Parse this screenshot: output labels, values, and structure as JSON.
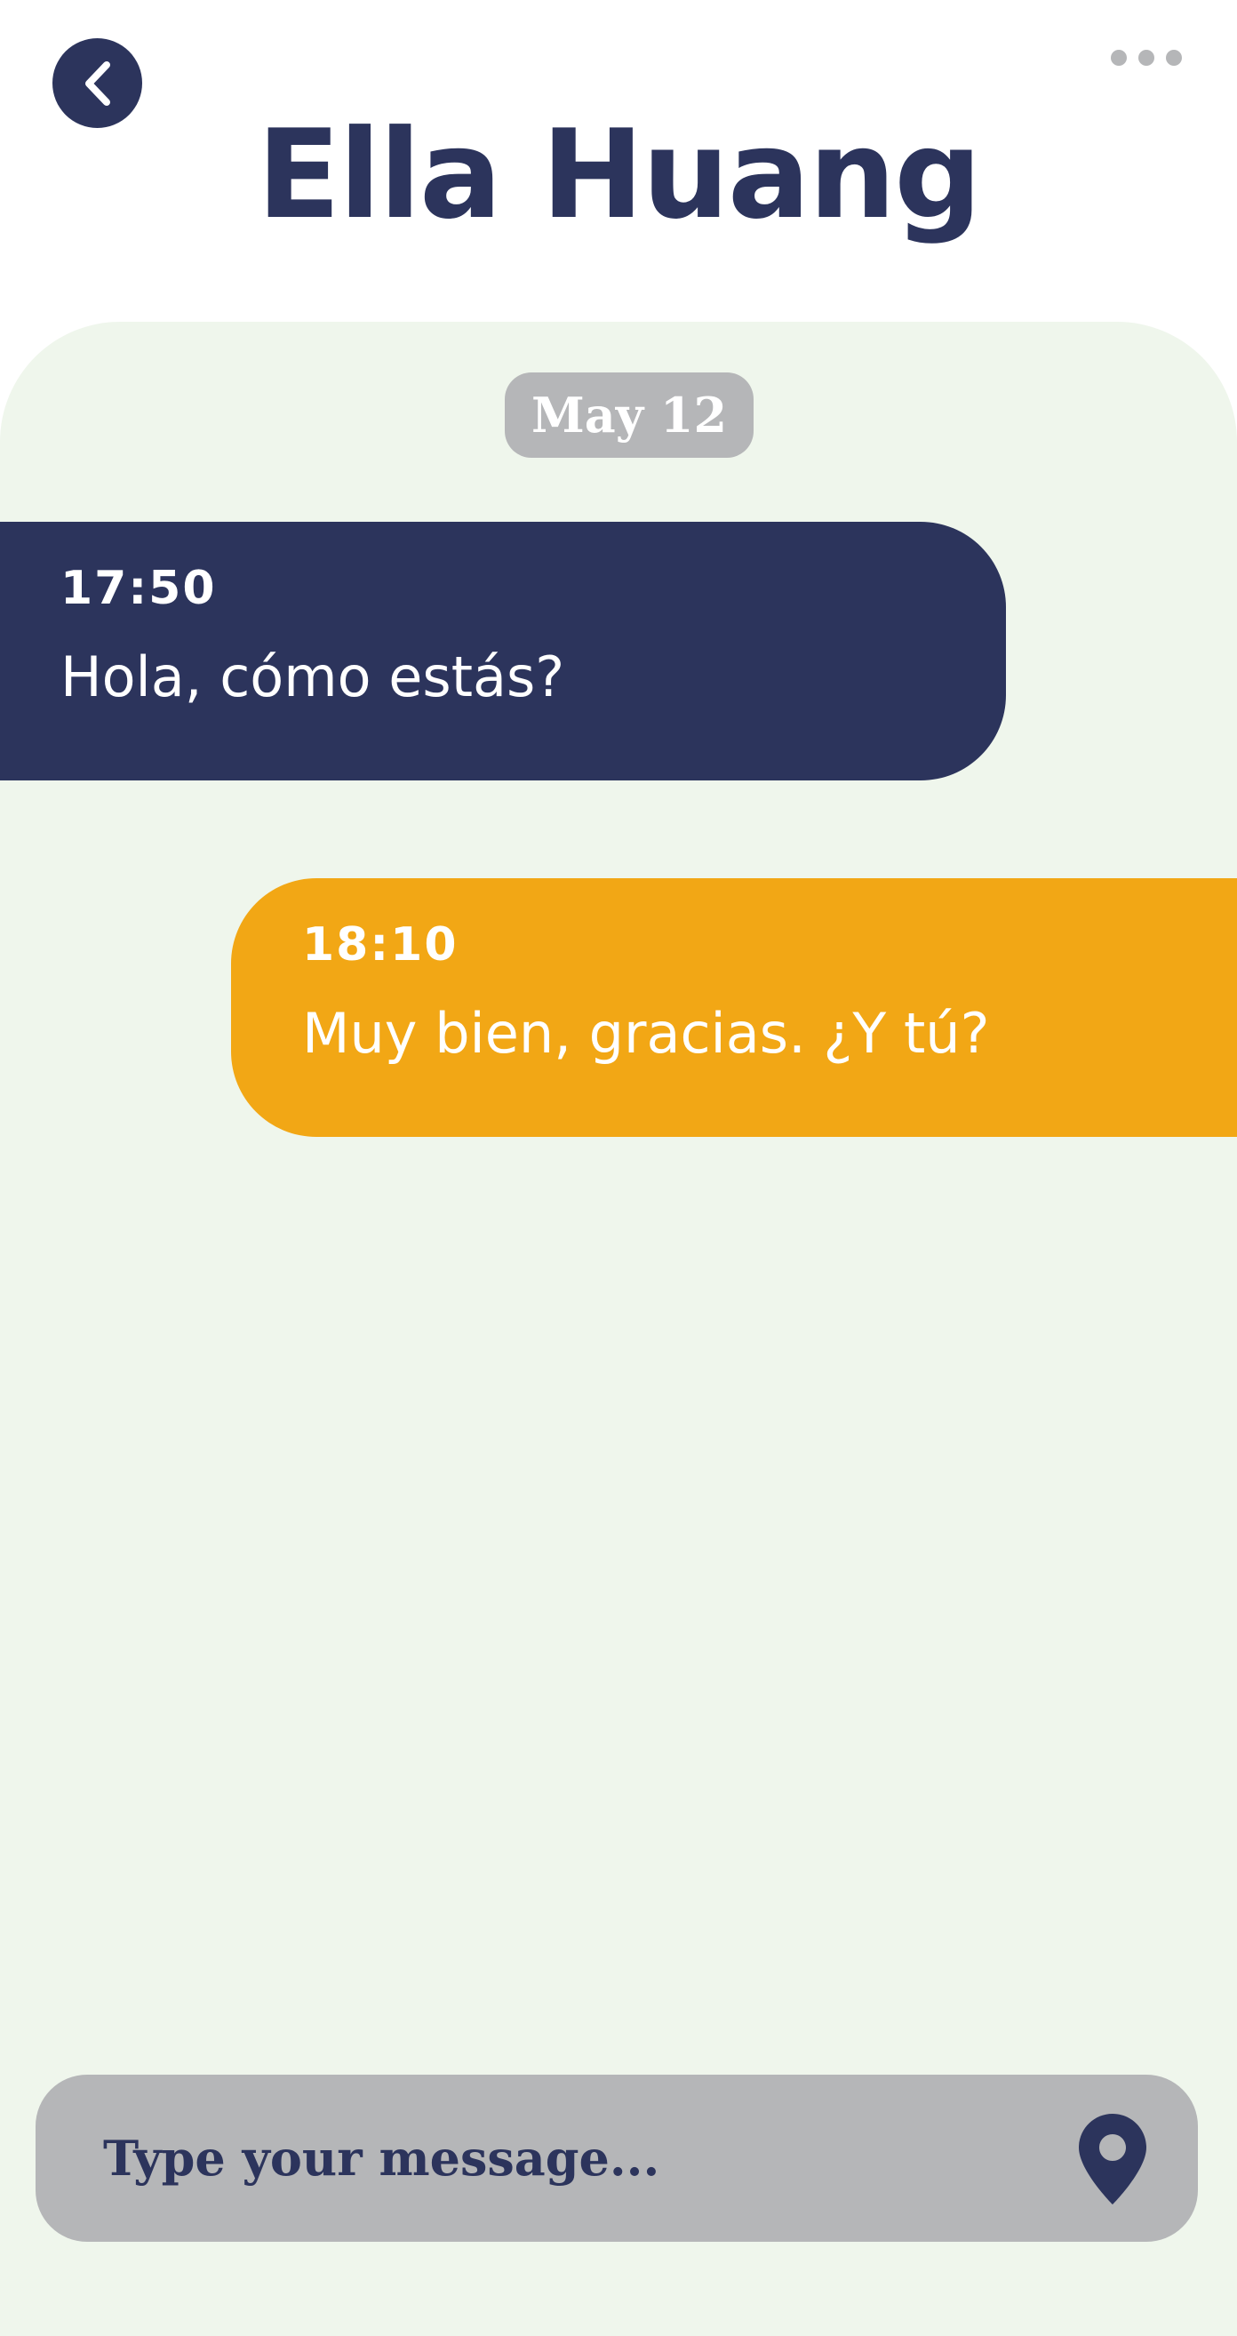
{
  "header": {
    "title": "Ella Huang",
    "back_icon": "chevron-left-icon",
    "more_icon": "more-horizontal-icon"
  },
  "chat": {
    "date_label": "May 12",
    "messages": [
      {
        "direction": "received",
        "time": "17:50",
        "text": "Hola, cómo estás?"
      },
      {
        "direction": "sent",
        "time": "18:10",
        "text": "Muy bien, gracias. ¿Y tú?"
      }
    ]
  },
  "composer": {
    "placeholder": "Type your message...",
    "value": "",
    "location_icon": "map-pin-icon"
  },
  "colors": {
    "primary": "#2c345c",
    "accent": "#f2a715",
    "chat_background": "#eff6ec",
    "neutral": "#b5b6b8"
  }
}
